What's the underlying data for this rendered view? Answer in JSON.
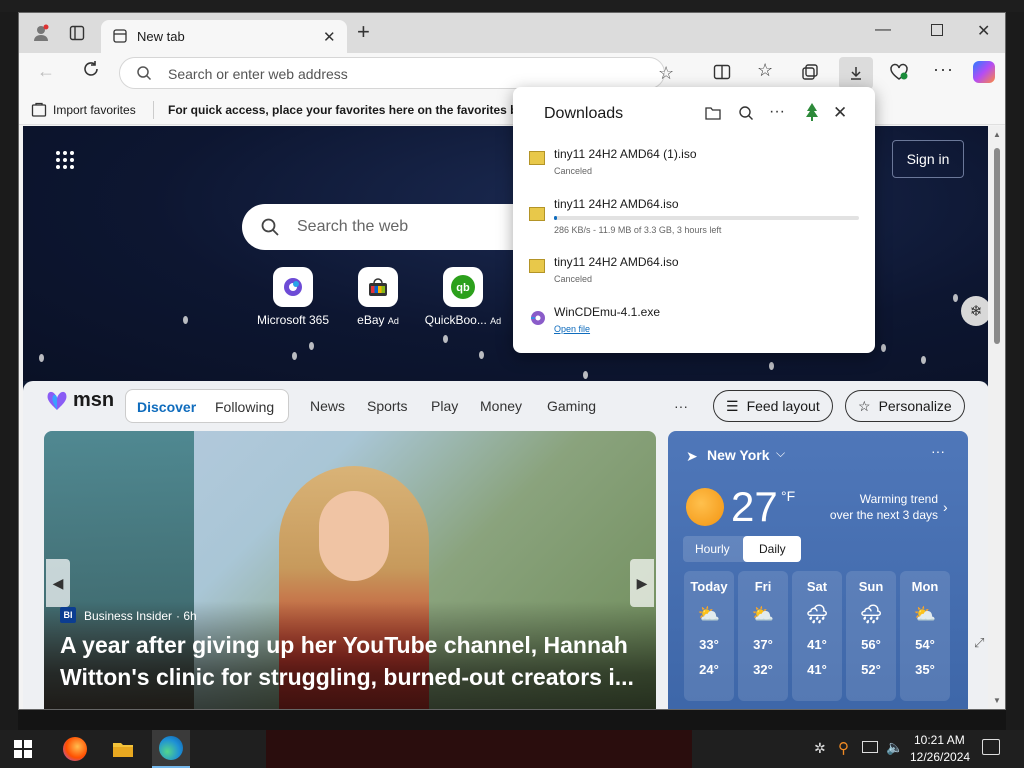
{
  "browser": {
    "tab_title": "New tab",
    "address_placeholder": "Search or enter web address",
    "favorites": {
      "import_label": "Import favorites",
      "hint": "For quick access, place your favorites here on the favorites bar."
    }
  },
  "newtab": {
    "search_placeholder": "Search the web",
    "signin_label": "Sign in",
    "quick_links": [
      {
        "label": "Microsoft 365"
      },
      {
        "label": "eBay",
        "ad": "Ad"
      },
      {
        "label": "QuickBoo...",
        "ad": "Ad"
      }
    ]
  },
  "downloads": {
    "title": "Downloads",
    "items": [
      {
        "name": "tiny11 24H2 AMD64 (1).iso",
        "status": "Canceled"
      },
      {
        "name": "tiny11 24H2 AMD64.iso",
        "status": "286 KB/s - 11.9 MB of 3.3 GB, 3 hours left",
        "progress": 0.004
      },
      {
        "name": "tiny11 24H2 AMD64.iso",
        "status": "Canceled"
      },
      {
        "name": "WinCDEmu-4.1.exe",
        "status": "Open file"
      }
    ]
  },
  "msn": {
    "logo": "msn",
    "tabs": [
      "Discover",
      "Following"
    ],
    "nav": [
      "News",
      "Sports",
      "Play",
      "Money",
      "Gaming"
    ],
    "more": "···",
    "feed_layout": "Feed layout",
    "personalize": "Personalize",
    "story": {
      "source": "Business Insider",
      "time": "· 6h",
      "headline_line1": "A year after giving up her YouTube channel, Hannah",
      "headline_line2": "Witton's clinic for struggling, burned-out creators i..."
    },
    "weather": {
      "location": "New York",
      "temp": "27",
      "unit": "°F",
      "trend_line1": "Warming trend",
      "trend_line2": "over the next 3 days",
      "hourly": "Hourly",
      "daily": "Daily",
      "days": [
        {
          "day": "Today",
          "hi": "33°",
          "lo": "24°"
        },
        {
          "day": "Fri",
          "hi": "37°",
          "lo": "32°"
        },
        {
          "day": "Sat",
          "hi": "41°",
          "lo": "41°"
        },
        {
          "day": "Sun",
          "hi": "56°",
          "lo": "52°"
        },
        {
          "day": "Mon",
          "hi": "54°",
          "lo": "35°"
        }
      ]
    }
  },
  "taskbar": {
    "time": "10:21 AM",
    "date": "12/26/2024"
  }
}
